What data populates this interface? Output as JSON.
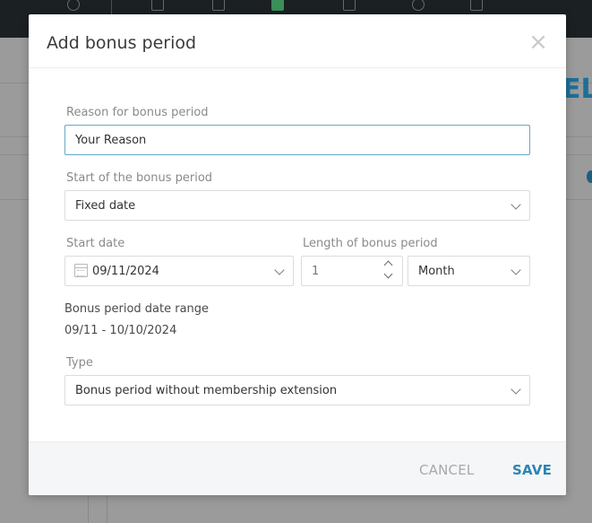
{
  "modal": {
    "title": "Add bonus period",
    "close_symbol": "×",
    "reason": {
      "label": "Reason for bonus period",
      "value": "Your Reason"
    },
    "start_type": {
      "label": "Start of the bonus period",
      "value": "Fixed date"
    },
    "start_date": {
      "label": "Start date",
      "value": "09/11/2024"
    },
    "length": {
      "label": "Length of bonus period",
      "value": "1",
      "unit": "Month"
    },
    "date_range": {
      "label": "Bonus period date range",
      "value": "09/11 - 10/10/2024"
    },
    "type": {
      "label": "Type",
      "value": "Bonus period without membership extension"
    },
    "footer": {
      "cancel_label": "CANCEL",
      "save_label": "SAVE"
    }
  },
  "background": {
    "brand_fragment": "EL",
    "toolbar_icons": [
      "star-icon",
      "grid-icon",
      "users-icon",
      "id-card-icon",
      "calendar-icon",
      "euro-icon",
      "sliders-icon",
      "more-icon"
    ],
    "accent_color": "#2a85b5",
    "active_icon_color": "#3a8f5a"
  }
}
